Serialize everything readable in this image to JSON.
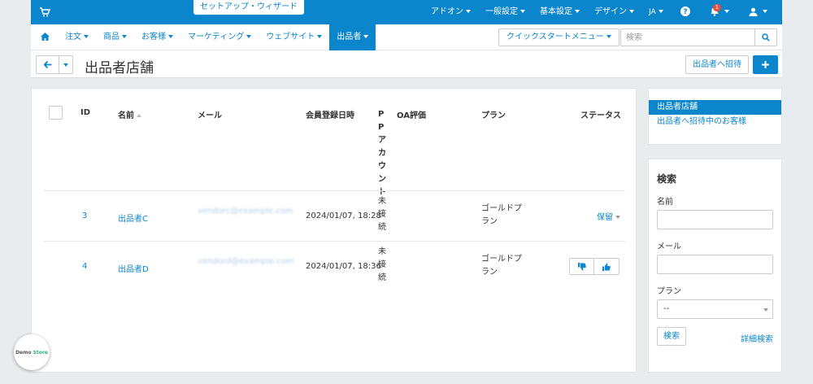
{
  "topbar": {
    "wizard": "セットアップ・ウィザード",
    "nav": [
      "アドオン",
      "一般設定",
      "基本設定",
      "デザイン",
      "JA"
    ],
    "notifications_count": "1"
  },
  "nav2": {
    "items": [
      "注文",
      "商品",
      "お客様",
      "マーケティング",
      "ウェブサイト",
      "出品者"
    ],
    "quickstart": "クイックスタートメニュー",
    "search_placeholder": "検索"
  },
  "page": {
    "title": "出品者店舗",
    "invite_button": "出品者へ招待"
  },
  "table": {
    "headers": {
      "id": "ID",
      "name": "名前",
      "email": "メール",
      "registered": "会員登録日時",
      "pp": "PPアカウント",
      "oa": "OA評価",
      "plan": "プラン",
      "status": "ステータス"
    },
    "rows": [
      {
        "id": "3",
        "name": "出品者C",
        "email": "vendorc@example.com",
        "registered": "2024/01/07, 18:28",
        "pp": "未接続",
        "plan": "ゴールドプラン",
        "status": "保留"
      },
      {
        "id": "4",
        "name": "出品者D",
        "email": "vendord@example.com",
        "registered": "2024/01/07, 18:36",
        "pp": "未接続",
        "plan": "ゴールドプラン",
        "status": ""
      }
    ]
  },
  "sidebar": {
    "links": [
      "出品者店舗",
      "出品者へ招待中のお客様"
    ],
    "search": {
      "title": "検索",
      "name_label": "名前",
      "email_label": "メール",
      "plan_label": "プラン",
      "plan_value": "--",
      "search_button": "検索",
      "advanced": "詳細検索"
    }
  },
  "demo_badge": {
    "part1": "Demo",
    "part2": "Store"
  },
  "colors": {
    "primary": "#0b86cc",
    "background": "#e9ecef",
    "badge": "#e74c3c"
  }
}
